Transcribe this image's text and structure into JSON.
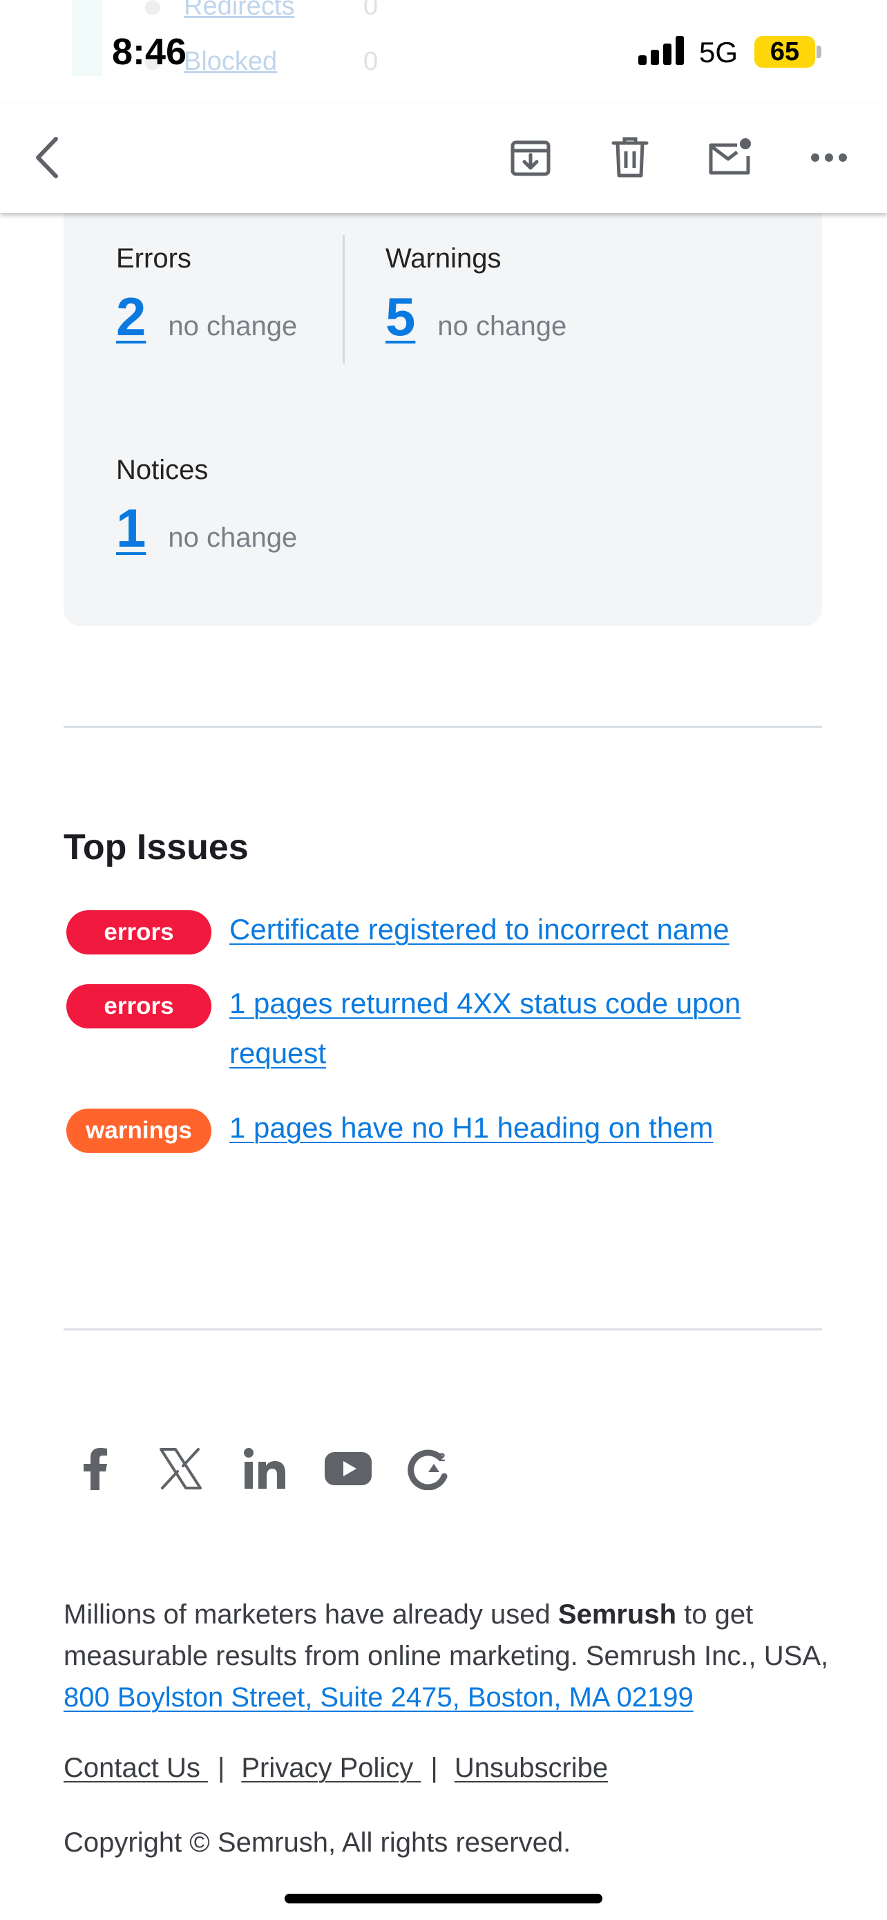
{
  "status_bar": {
    "time": "8:46",
    "network": "5G",
    "battery": "65"
  },
  "background_peek": {
    "items": [
      {
        "label": "Redirects",
        "value": "0"
      },
      {
        "label": "Blocked",
        "value": "0"
      }
    ]
  },
  "toolbar": {
    "icons": [
      "back-chevron-icon",
      "archive-icon",
      "trash-icon",
      "mail-unread-icon",
      "more-icon"
    ]
  },
  "stats": {
    "errors": {
      "label": "Errors",
      "value": "2",
      "change": "no change"
    },
    "warnings": {
      "label": "Warnings",
      "value": "5",
      "change": "no change"
    },
    "notices": {
      "label": "Notices",
      "value": "1",
      "change": "no change"
    }
  },
  "top_issues": {
    "title": "Top Issues",
    "items": [
      {
        "badge": "errors",
        "text": "Certificate registered to incorrect name"
      },
      {
        "badge": "errors",
        "text": "1 pages returned 4XX status code upon request"
      },
      {
        "badge": "warnings",
        "text": "1 pages have no H1 heading on them"
      }
    ]
  },
  "colors": {
    "accent": "#0a7ae0",
    "error_badge": "#f1193d",
    "warning_badge": "#ff642d",
    "card_bg": "#f4f5f7",
    "icon_gray": "#5f6368"
  },
  "social": [
    "facebook-icon",
    "x-icon",
    "linkedin-icon",
    "youtube-icon",
    "g2-icon"
  ],
  "footer": {
    "text_before": "Millions of marketers have already used ",
    "brand": "Semrush",
    "text_after": " to get measurable results from online marketing. Semrush Inc., USA, ",
    "address": "800 Boylston Street, Suite 2475, Boston, MA 02199",
    "links": {
      "contact": "Contact Us ",
      "privacy": "Privacy Policy ",
      "unsubscribe": "Unsubscribe"
    },
    "separator": "|",
    "copyright": "Copyright © Semrush, All rights reserved."
  }
}
